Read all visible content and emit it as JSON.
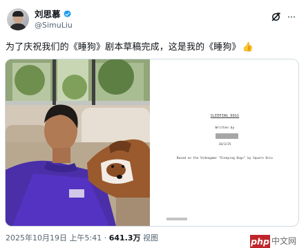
{
  "tweet": {
    "author": {
      "display_name": "刘思慕",
      "handle": "@SimuLiu"
    },
    "text": "为了庆祝我们的《睡狗》剧本草稿完成，这是我的《睡狗》",
    "text_emoji": "👍",
    "timestamp": "2025年10月19日 上午5:41",
    "separator": "·",
    "views_count": "641.3万",
    "views_label": "视图"
  },
  "script_page": {
    "title": "SLEEPING DOGS",
    "written_by": "Written by",
    "date": "10/3/25",
    "based_on": "Based on the Videogame \"Sleeping Dogs\" by Square Enix"
  },
  "watermark": {
    "brand": "php",
    "site": "中文网"
  },
  "colors": {
    "verified": "#1d9bf0",
    "text": "#0f1419",
    "secondary": "#536471",
    "watermark_red": "#c0252c"
  }
}
